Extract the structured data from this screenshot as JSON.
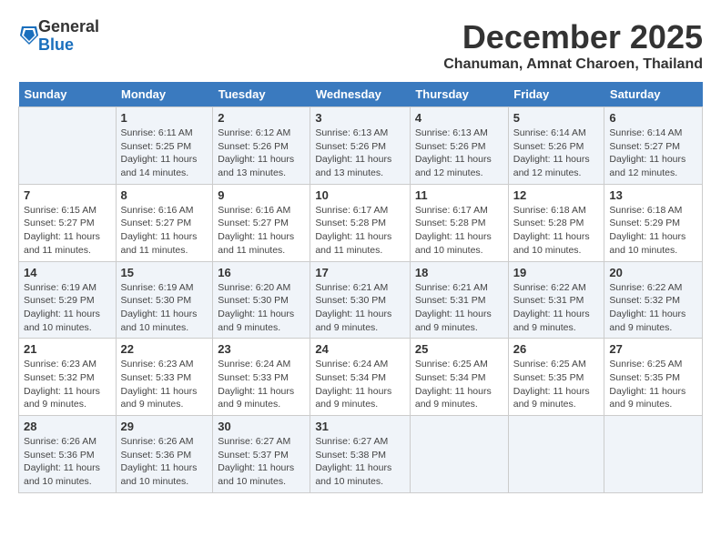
{
  "logo": {
    "general": "General",
    "blue": "Blue"
  },
  "title": "December 2025",
  "location": "Chanuman, Amnat Charoen, Thailand",
  "days_of_week": [
    "Sunday",
    "Monday",
    "Tuesday",
    "Wednesday",
    "Thursday",
    "Friday",
    "Saturday"
  ],
  "weeks": [
    [
      {
        "day": "",
        "info": ""
      },
      {
        "day": "1",
        "info": "Sunrise: 6:11 AM\nSunset: 5:25 PM\nDaylight: 11 hours\nand 14 minutes."
      },
      {
        "day": "2",
        "info": "Sunrise: 6:12 AM\nSunset: 5:26 PM\nDaylight: 11 hours\nand 13 minutes."
      },
      {
        "day": "3",
        "info": "Sunrise: 6:13 AM\nSunset: 5:26 PM\nDaylight: 11 hours\nand 13 minutes."
      },
      {
        "day": "4",
        "info": "Sunrise: 6:13 AM\nSunset: 5:26 PM\nDaylight: 11 hours\nand 12 minutes."
      },
      {
        "day": "5",
        "info": "Sunrise: 6:14 AM\nSunset: 5:26 PM\nDaylight: 11 hours\nand 12 minutes."
      },
      {
        "day": "6",
        "info": "Sunrise: 6:14 AM\nSunset: 5:27 PM\nDaylight: 11 hours\nand 12 minutes."
      }
    ],
    [
      {
        "day": "7",
        "info": "Sunrise: 6:15 AM\nSunset: 5:27 PM\nDaylight: 11 hours\nand 11 minutes."
      },
      {
        "day": "8",
        "info": "Sunrise: 6:16 AM\nSunset: 5:27 PM\nDaylight: 11 hours\nand 11 minutes."
      },
      {
        "day": "9",
        "info": "Sunrise: 6:16 AM\nSunset: 5:27 PM\nDaylight: 11 hours\nand 11 minutes."
      },
      {
        "day": "10",
        "info": "Sunrise: 6:17 AM\nSunset: 5:28 PM\nDaylight: 11 hours\nand 11 minutes."
      },
      {
        "day": "11",
        "info": "Sunrise: 6:17 AM\nSunset: 5:28 PM\nDaylight: 11 hours\nand 10 minutes."
      },
      {
        "day": "12",
        "info": "Sunrise: 6:18 AM\nSunset: 5:28 PM\nDaylight: 11 hours\nand 10 minutes."
      },
      {
        "day": "13",
        "info": "Sunrise: 6:18 AM\nSunset: 5:29 PM\nDaylight: 11 hours\nand 10 minutes."
      }
    ],
    [
      {
        "day": "14",
        "info": "Sunrise: 6:19 AM\nSunset: 5:29 PM\nDaylight: 11 hours\nand 10 minutes."
      },
      {
        "day": "15",
        "info": "Sunrise: 6:19 AM\nSunset: 5:30 PM\nDaylight: 11 hours\nand 10 minutes."
      },
      {
        "day": "16",
        "info": "Sunrise: 6:20 AM\nSunset: 5:30 PM\nDaylight: 11 hours\nand 9 minutes."
      },
      {
        "day": "17",
        "info": "Sunrise: 6:21 AM\nSunset: 5:30 PM\nDaylight: 11 hours\nand 9 minutes."
      },
      {
        "day": "18",
        "info": "Sunrise: 6:21 AM\nSunset: 5:31 PM\nDaylight: 11 hours\nand 9 minutes."
      },
      {
        "day": "19",
        "info": "Sunrise: 6:22 AM\nSunset: 5:31 PM\nDaylight: 11 hours\nand 9 minutes."
      },
      {
        "day": "20",
        "info": "Sunrise: 6:22 AM\nSunset: 5:32 PM\nDaylight: 11 hours\nand 9 minutes."
      }
    ],
    [
      {
        "day": "21",
        "info": "Sunrise: 6:23 AM\nSunset: 5:32 PM\nDaylight: 11 hours\nand 9 minutes."
      },
      {
        "day": "22",
        "info": "Sunrise: 6:23 AM\nSunset: 5:33 PM\nDaylight: 11 hours\nand 9 minutes."
      },
      {
        "day": "23",
        "info": "Sunrise: 6:24 AM\nSunset: 5:33 PM\nDaylight: 11 hours\nand 9 minutes."
      },
      {
        "day": "24",
        "info": "Sunrise: 6:24 AM\nSunset: 5:34 PM\nDaylight: 11 hours\nand 9 minutes."
      },
      {
        "day": "25",
        "info": "Sunrise: 6:25 AM\nSunset: 5:34 PM\nDaylight: 11 hours\nand 9 minutes."
      },
      {
        "day": "26",
        "info": "Sunrise: 6:25 AM\nSunset: 5:35 PM\nDaylight: 11 hours\nand 9 minutes."
      },
      {
        "day": "27",
        "info": "Sunrise: 6:25 AM\nSunset: 5:35 PM\nDaylight: 11 hours\nand 9 minutes."
      }
    ],
    [
      {
        "day": "28",
        "info": "Sunrise: 6:26 AM\nSunset: 5:36 PM\nDaylight: 11 hours\nand 10 minutes."
      },
      {
        "day": "29",
        "info": "Sunrise: 6:26 AM\nSunset: 5:36 PM\nDaylight: 11 hours\nand 10 minutes."
      },
      {
        "day": "30",
        "info": "Sunrise: 6:27 AM\nSunset: 5:37 PM\nDaylight: 11 hours\nand 10 minutes."
      },
      {
        "day": "31",
        "info": "Sunrise: 6:27 AM\nSunset: 5:38 PM\nDaylight: 11 hours\nand 10 minutes."
      },
      {
        "day": "",
        "info": ""
      },
      {
        "day": "",
        "info": ""
      },
      {
        "day": "",
        "info": ""
      }
    ]
  ]
}
